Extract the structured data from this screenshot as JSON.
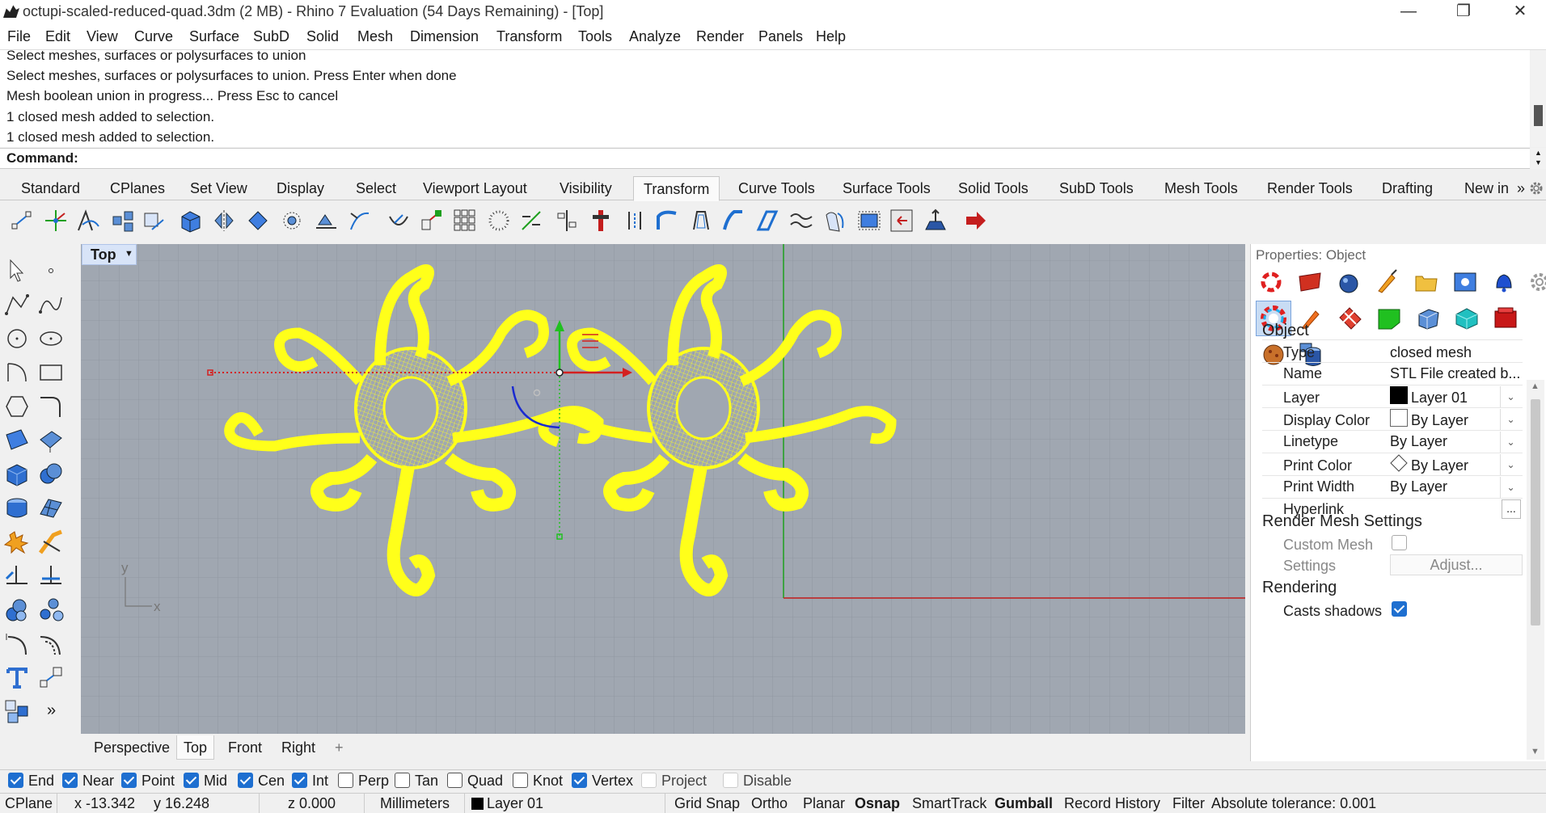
{
  "window": {
    "title": "octupi-scaled-reduced-quad.3dm (2 MB) - Rhino 7 Evaluation (54 Days Remaining) - [Top]",
    "minimize": "—",
    "restore": "❐",
    "close": "✕"
  },
  "menu": [
    "File",
    "Edit",
    "View",
    "Curve",
    "Surface",
    "SubD",
    "Solid",
    "Mesh",
    "Dimension",
    "Transform",
    "Tools",
    "Analyze",
    "Render",
    "Panels",
    "Help"
  ],
  "history": [
    "Select meshes, surfaces or polysurfaces to union",
    "Select meshes, surfaces or polysurfaces to union. Press Enter when done",
    "Mesh boolean union in progress... Press Esc to cancel",
    "1 closed mesh added to selection.",
    "1 closed mesh added to selection."
  ],
  "command": {
    "label": "Command:",
    "value": ""
  },
  "toolbar_tabs": [
    "Standard",
    "CPlanes",
    "Set View",
    "Display",
    "Select",
    "Viewport Layout",
    "Visibility",
    "Transform",
    "Curve Tools",
    "Surface Tools",
    "Solid Tools",
    "SubD Tools",
    "Mesh Tools",
    "Render Tools",
    "Drafting",
    "New in"
  ],
  "toolbar_tabs_more": "»",
  "active_toolbar_tab": "Transform",
  "viewport": {
    "label": "Top",
    "dropdown": "▼",
    "axis_x": "x",
    "axis_y": "y",
    "tabs": [
      "Perspective",
      "Top",
      "Front",
      "Right"
    ],
    "add_tab": "+",
    "active_tab": "Top"
  },
  "left_more": "»",
  "properties": {
    "header": "Properties: Object",
    "section_object": "Object",
    "rows": [
      {
        "label": "Type",
        "value": "closed mesh"
      },
      {
        "label": "Name",
        "value": "STL File created b..."
      },
      {
        "label": "Layer",
        "value": "Layer 01"
      },
      {
        "label": "Display Color",
        "value": "By Layer"
      },
      {
        "label": "Linetype",
        "value": "By Layer"
      },
      {
        "label": "Print Color",
        "value": "By Layer"
      },
      {
        "label": "Print Width",
        "value": "By Layer"
      },
      {
        "label": "Hyperlink",
        "value": ""
      }
    ],
    "hyperlink_button": "...",
    "section_render_mesh": "Render Mesh Settings",
    "custom_mesh_label": "Custom Mesh",
    "custom_mesh_checked": false,
    "settings_label": "Settings",
    "adjust_button": "Adjust...",
    "section_rendering": "Rendering",
    "casts_shadows_label": "Casts shadows",
    "casts_shadows_checked": true
  },
  "osnaps": [
    {
      "label": "End",
      "checked": true
    },
    {
      "label": "Near",
      "checked": true
    },
    {
      "label": "Point",
      "checked": true
    },
    {
      "label": "Mid",
      "checked": true
    },
    {
      "label": "Cen",
      "checked": true
    },
    {
      "label": "Int",
      "checked": true
    },
    {
      "label": "Perp",
      "checked": false
    },
    {
      "label": "Tan",
      "checked": false
    },
    {
      "label": "Quad",
      "checked": false
    },
    {
      "label": "Knot",
      "checked": false
    },
    {
      "label": "Vertex",
      "checked": true
    },
    {
      "label": "Project",
      "checked": false
    },
    {
      "label": "Disable",
      "checked": false
    }
  ],
  "status": {
    "cplane": "CPlane",
    "x": "x -13.342",
    "y": "y 16.248",
    "z": "z 0.000",
    "units": "Millimeters",
    "layer": "Layer 01",
    "grid_snap": "Grid Snap",
    "ortho": "Ortho",
    "planar": "Planar",
    "osnap": "Osnap",
    "smarttrack": "SmartTrack",
    "gumball": "Gumball",
    "record_history": "Record History",
    "filter": "Filter",
    "tolerance": "Absolute tolerance: 0.001"
  },
  "colors": {
    "viewport_bg": "#a0a7b1",
    "grid_line": "#8d949e",
    "mesh_selected": "#ffff1a",
    "x_axis": "#c41e1e",
    "y_axis": "#1ea01e",
    "accent": "#1e6fd0"
  }
}
